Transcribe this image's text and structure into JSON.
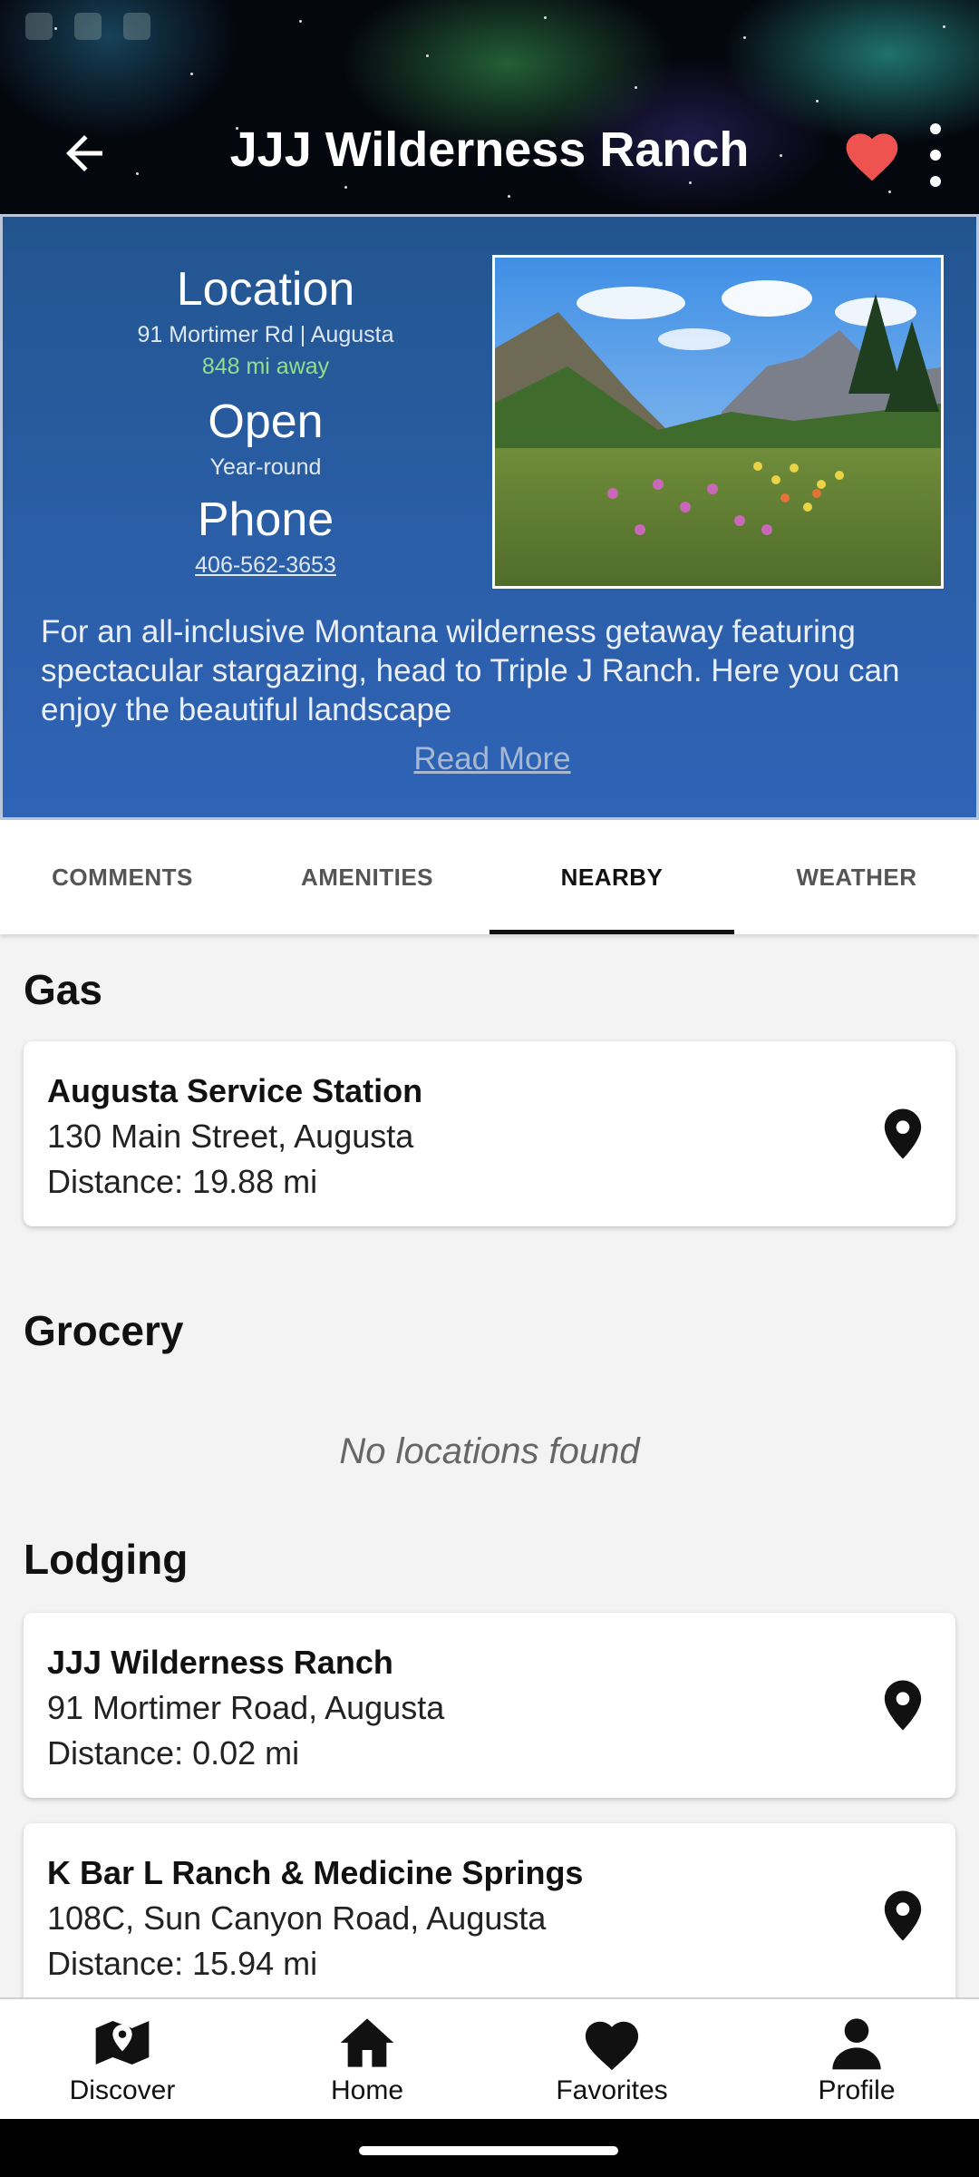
{
  "header": {
    "title": "JJJ Wilderness Ranch",
    "icons": {
      "back": "arrow-left-icon",
      "favorite": "heart-icon",
      "more": "more-vert-icon"
    }
  },
  "info": {
    "location_label": "Location",
    "address": "91 Mortimer Rd | Augusta",
    "distance_away": "848 mi away",
    "open_label": "Open",
    "open_value": "Year-round",
    "phone_label": "Phone",
    "phone_value": "406-562-3653",
    "description": "For an all-inclusive Montana wilderness getaway featuring spectacular stargazing, head to Triple J Ranch. Here you can enjoy the beautiful landscape",
    "read_more": "Read More"
  },
  "tabs": [
    {
      "label": "COMMENTS",
      "active": false
    },
    {
      "label": "AMENITIES",
      "active": false
    },
    {
      "label": "NEARBY",
      "active": true
    },
    {
      "label": "WEATHER",
      "active": false
    }
  ],
  "sections": {
    "gas": {
      "title": "Gas",
      "items": [
        {
          "name": "Augusta Service Station",
          "address": "130 Main Street, Augusta",
          "distance": "Distance: 19.88 mi"
        }
      ]
    },
    "grocery": {
      "title": "Grocery",
      "empty_text": "No locations found"
    },
    "lodging": {
      "title": "Lodging",
      "items": [
        {
          "name": "JJJ Wilderness Ranch",
          "address": "91 Mortimer Road, Augusta",
          "distance": "Distance: 0.02 mi"
        },
        {
          "name": "K Bar L Ranch & Medicine Springs",
          "address": "108C, Sun Canyon Road, Augusta",
          "distance": "Distance: 15.94 mi"
        }
      ]
    }
  },
  "bottom_nav": [
    {
      "label": "Discover",
      "icon": "map-icon"
    },
    {
      "label": "Home",
      "icon": "home-icon"
    },
    {
      "label": "Favorites",
      "icon": "heart-icon"
    },
    {
      "label": "Profile",
      "icon": "person-icon"
    }
  ],
  "colors": {
    "panel_blue": "#2b5fa9",
    "distance_green": "#8fe08a",
    "heart_red": "#ef5350"
  }
}
